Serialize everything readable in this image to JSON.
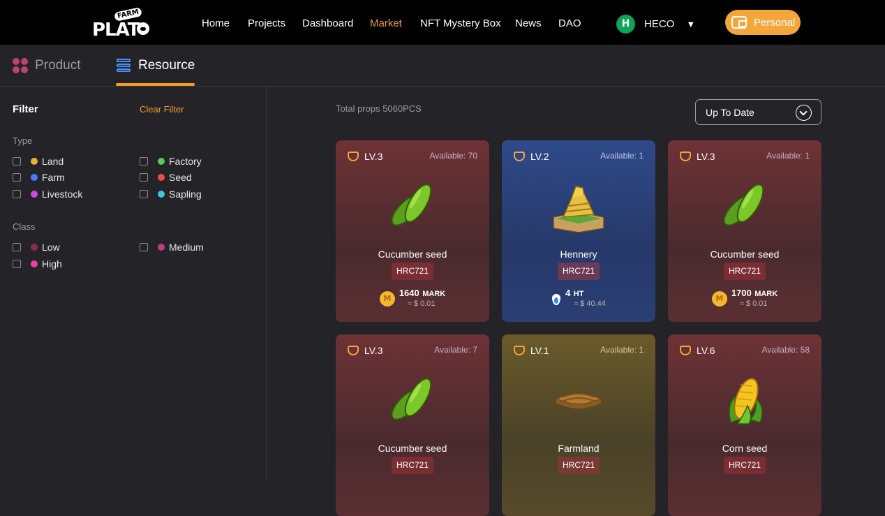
{
  "nav": {
    "logo_main": "PLAT",
    "logo_badge": "FARM",
    "items": [
      "Home",
      "Projects",
      "Dashboard",
      "Market",
      "NFT Mystery Box",
      "News",
      "DAO"
    ],
    "active": "Market",
    "chain_label": "HECO",
    "chain_caret": "▼",
    "chain_icon_glyph": "H",
    "personal_label": "Personal"
  },
  "tabs": {
    "product": "Product",
    "resource": "Resource"
  },
  "filter": {
    "title": "Filter",
    "clear": "Clear Filter",
    "type_label": "Type",
    "type_options": [
      {
        "label": "Land",
        "color": "#e8b23a"
      },
      {
        "label": "Factory",
        "color": "#5ac85a"
      },
      {
        "label": "Farm",
        "color": "#4a7cf5"
      },
      {
        "label": "Seed",
        "color": "#f04a4a"
      },
      {
        "label": "Livestock",
        "color": "#d04ae8"
      },
      {
        "label": "Sapling",
        "color": "#3ac8d8"
      }
    ],
    "class_label": "Class",
    "class_options": [
      {
        "label": "Low",
        "color": "#8a2a58"
      },
      {
        "label": "Medium",
        "color": "#c03a8a"
      },
      {
        "label": "High",
        "color": "#f03aa8"
      }
    ]
  },
  "listing": {
    "total": "Total props  5060PCS",
    "sort": "Up To Date"
  },
  "cards": [
    {
      "level": "LV.3",
      "available": "Available:  70",
      "name": "Cucumber seed",
      "standard": "HRC721",
      "amount": "1640",
      "unit": "MARK",
      "usd": "≈ $ 0.01",
      "theme": "red",
      "art": "cucumber"
    },
    {
      "level": "LV.2",
      "available": "Available:  1",
      "name": "Hennery",
      "standard": "HRC721",
      "amount": "4",
      "unit": "HT",
      "usd": "≈ $ 40.44",
      "theme": "blue",
      "art": "hennery"
    },
    {
      "level": "LV.3",
      "available": "Available:  1",
      "name": "Cucumber seed",
      "standard": "HRC721",
      "amount": "1700",
      "unit": "MARK",
      "usd": "≈ $ 0.01",
      "theme": "red",
      "art": "cucumber"
    },
    {
      "level": "LV.3",
      "available": "Available:  7",
      "name": "Cucumber seed",
      "standard": "HRC721",
      "theme": "red",
      "art": "cucumber"
    },
    {
      "level": "LV.1",
      "available": "Available:  1",
      "name": "Farmland",
      "standard": "HRC721",
      "theme": "gold",
      "art": "farmland"
    },
    {
      "level": "LV.6",
      "available": "Available:  58",
      "name": "Corn seed",
      "standard": "HRC721",
      "theme": "red",
      "art": "corn"
    }
  ]
}
